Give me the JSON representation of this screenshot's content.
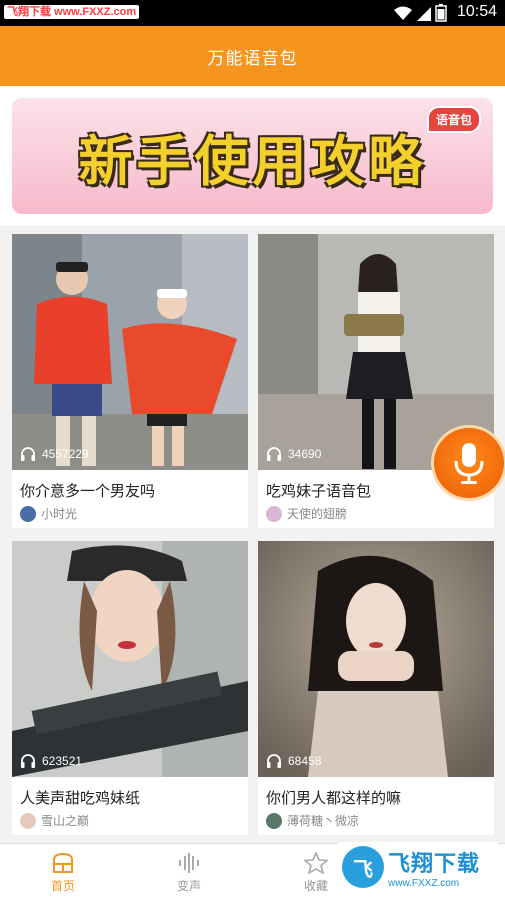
{
  "status_bar": {
    "watermark": "飞翔下载 www.FXXZ.com",
    "time": "10:54"
  },
  "app_bar": {
    "title": "万能语音包"
  },
  "banner": {
    "text": "新手使用攻略",
    "badge": "语音包"
  },
  "cards": [
    {
      "title": "你介意多一个男友吗",
      "plays": "4557229",
      "author": "小时光"
    },
    {
      "title": "吃鸡妹子语音包",
      "plays": "34690",
      "author": "天使的翅膀"
    },
    {
      "title": "人美声甜吃鸡妹纸",
      "plays": "623521",
      "author": "雪山之巅"
    },
    {
      "title": "你们男人都这样的嘛",
      "plays": "68458",
      "author": "薄荷糖丶微凉"
    }
  ],
  "bottom_nav": [
    {
      "label": "首页",
      "icon": "home-icon",
      "active": true
    },
    {
      "label": "变声",
      "icon": "sound-wave-icon",
      "active": false
    },
    {
      "label": "收藏",
      "icon": "star-icon",
      "active": false
    }
  ],
  "watermark_br": {
    "big": "飞翔下载",
    "small": "www.FXXZ.com"
  },
  "colors": {
    "accent": "#f7941d",
    "mic": "#f26a0c"
  }
}
